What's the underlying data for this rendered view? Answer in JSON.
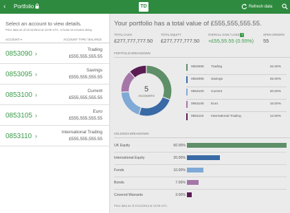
{
  "topbar": {
    "back_glyph": "‹",
    "title": "Portfolio",
    "logo_text": "TD",
    "refresh_label": "Refresh data",
    "icons": [
      "back-icon",
      "lock-icon",
      "refresh-icon",
      "search-icon"
    ]
  },
  "left": {
    "intro": "Select an account to view details.",
    "asof": "Price data as of 21/11/2013 at 13:00 UTC. At least 15 minutes delay",
    "col_account": "ACCOUNT ▾",
    "col_type": "ACCOUNT TYPE / BALANCE",
    "accounts": [
      {
        "number": "0853090",
        "type": "Trading",
        "balance": "£555,555,555.55"
      },
      {
        "number": "0853095",
        "type": "Savings",
        "balance": "£555,555,555.55"
      },
      {
        "number": "0853100",
        "type": "Current",
        "balance": "£555,555,555.55"
      },
      {
        "number": "0853105",
        "type": "Euro",
        "balance": "£555,555,555.55"
      },
      {
        "number": "0853110",
        "type": "International Trading",
        "balance": "£555,555,555.55"
      }
    ],
    "arrow_glyph": "›"
  },
  "right": {
    "headline": "Your portfolio has a total value of £555,555,555.55.",
    "stats": {
      "cash_label": "TOTAL CASH",
      "cash_value": "£277,777,777.50",
      "equity_label": "TOTAL EQUITY",
      "equity_value": "£277,777,777.50",
      "gain_label": "OVERALL GAIN / LOSS",
      "gain_help": "?",
      "gain_value": "+£55,55.55 (0.55%)",
      "orders_label": "OPEN ORDERS",
      "orders_value": "55"
    },
    "breakdown_title": "PORTFOLIO BREAKDOWN",
    "donut": {
      "count": "5",
      "label": "ACCOUNTS"
    },
    "legend": [
      {
        "account": "0853090",
        "name": "Trading",
        "pct": "32.00%",
        "value": 32,
        "color": "#5e8f68"
      },
      {
        "account": "0853095",
        "name": "Savings",
        "pct": "25.00%",
        "value": 25,
        "color": "#3a6aa6"
      },
      {
        "account": "0853100",
        "name": "Current",
        "pct": "20.00%",
        "value": 20,
        "color": "#7fa9d6"
      },
      {
        "account": "0853105",
        "name": "Euro",
        "pct": "15.00%",
        "value": 15,
        "color": "#a676a8"
      },
      {
        "account": "0853110",
        "name": "International Trading",
        "pct": "12.00%",
        "value": 12,
        "color": "#5b1c53"
      }
    ],
    "holdings_title": "HOLDINGS BREAKDOWN",
    "holdings": [
      {
        "name": "UK Equity",
        "pct": "60.00%",
        "value": 60,
        "color": "#5e8f68"
      },
      {
        "name": "International Equity",
        "pct": "20.00%",
        "value": 20,
        "color": "#3a6aa6"
      },
      {
        "name": "Funds",
        "pct": "10.00%",
        "value": 10,
        "color": "#7fa9d6"
      },
      {
        "name": "Bonds",
        "pct": "7.00%",
        "value": 7,
        "color": "#a676a8"
      },
      {
        "name": "Covered Warrants",
        "pct": "3.00%",
        "value": 3,
        "color": "#5b1c53"
      }
    ],
    "footer": "Price data as of 21/11/2013 at 13:00 UTC."
  }
}
